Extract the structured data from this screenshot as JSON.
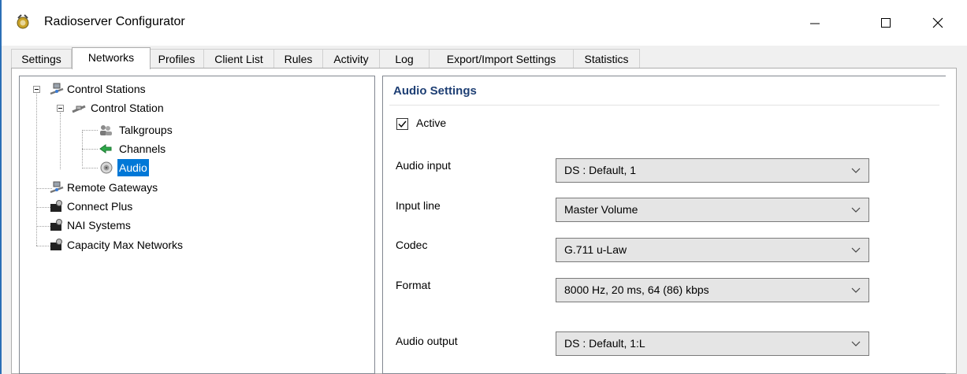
{
  "window": {
    "title": "Radioserver Configurator"
  },
  "tabs": [
    "Settings",
    "Networks",
    "Profiles",
    "Client List",
    "Rules",
    "Activity",
    "Log",
    "Export/Import Settings",
    "Statistics"
  ],
  "tree": {
    "control_stations": "Control Stations",
    "control_station": "Control Station",
    "talkgroups": "Talkgroups",
    "channels": "Channels",
    "audio": "Audio",
    "remote_gateways": "Remote Gateways",
    "connect_plus": "Connect Plus",
    "nai_systems": "NAI Systems",
    "capacity_max": "Capacity Max Networks"
  },
  "audio_settings": {
    "title": "Audio Settings",
    "active_label": "Active",
    "active_checked": true,
    "fields": [
      {
        "label": "Audio input",
        "value": "DS : Default, 1"
      },
      {
        "label": "Input line",
        "value": "Master Volume"
      },
      {
        "label": "Codec",
        "value": "G.711 u-Law"
      },
      {
        "label": "Format",
        "value": "8000 Hz, 20 ms, 64 (86) kbps"
      },
      {
        "label": "Audio output",
        "value": "DS : Default, 1:L"
      }
    ]
  }
}
